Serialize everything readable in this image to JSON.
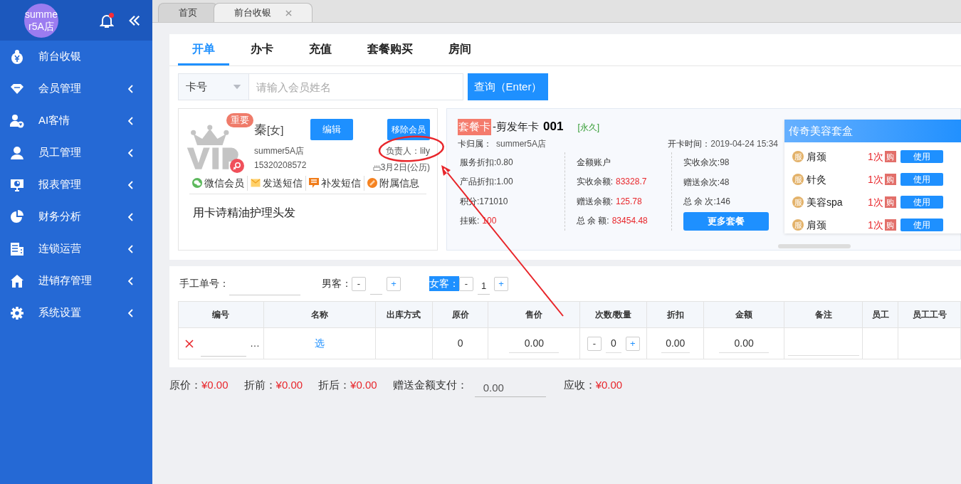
{
  "sidebar": {
    "logo_text": "summer5A店",
    "has_unread_notice": true,
    "items": [
      {
        "label": "前台收银",
        "has_submenu": false
      },
      {
        "label": "会员管理",
        "has_submenu": true
      },
      {
        "label": "AI客情",
        "has_submenu": true
      },
      {
        "label": "员工管理",
        "has_submenu": true
      },
      {
        "label": "报表管理",
        "has_submenu": true
      },
      {
        "label": "财务分析",
        "has_submenu": true
      },
      {
        "label": "连锁运营",
        "has_submenu": true
      },
      {
        "label": "进销存管理",
        "has_submenu": true
      },
      {
        "label": "系统设置",
        "has_submenu": true
      }
    ]
  },
  "page_tabs": [
    {
      "label": "首页",
      "selected": false,
      "closable": false
    },
    {
      "label": "前台收银",
      "selected": true,
      "closable": true
    }
  ],
  "sub_tabs": [
    {
      "label": "开单",
      "selected": true
    },
    {
      "label": "办卡",
      "selected": false
    },
    {
      "label": "充值",
      "selected": false
    },
    {
      "label": "套餐购买",
      "selected": false
    },
    {
      "label": "房间",
      "selected": false
    }
  ],
  "search": {
    "type_select": "卡号",
    "placeholder": "请输入会员姓名",
    "button": "查询（Enter）"
  },
  "member": {
    "badge": "重要",
    "name": "秦",
    "gender": "[女]",
    "store": "summer5A店",
    "phone": "15320208572",
    "edit_button": "编辑",
    "remove_button": "移除会员",
    "manager": "负责人：lily",
    "birthday": "3月2日(公历)",
    "actions": [
      {
        "kind": "wechat",
        "label": "微信会员"
      },
      {
        "kind": "sms",
        "label": "发送短信"
      },
      {
        "kind": "resend",
        "label": "补发短信"
      },
      {
        "kind": "extra",
        "label": "附属信息"
      }
    ],
    "note": "用卡诗精油护理头发"
  },
  "card": {
    "type_tag": "套餐卡",
    "name": "-剪发年卡",
    "number": "001",
    "validity": "[永久]",
    "owner_label": "卡归属：",
    "owner": "summer5A店",
    "open_time_label": "开卡时间：",
    "open_time": "2019-04-24 15:34",
    "columns": [
      [
        {
          "label": "服务折扣: ",
          "value": "0.80",
          "alert": false
        },
        {
          "label": "产品折扣: ",
          "value": "1.00",
          "alert": false
        },
        {
          "label": "积分: ",
          "value": "171010",
          "alert": false
        },
        {
          "label": "挂账: ",
          "value": "100",
          "alert": true
        }
      ],
      [
        {
          "label": "金额账户"
        },
        {
          "label": "实收余额: ",
          "value": "83328.7",
          "alert": true
        },
        {
          "label": "赠送余额: ",
          "value": "125.78",
          "alert": true
        },
        {
          "label": "总 余 额: ",
          "value": "83454.48",
          "alert": true
        }
      ],
      [
        {
          "label": "实收余次: ",
          "value": "98",
          "alert": false
        },
        {
          "label": "赠送余次: ",
          "value": "48",
          "alert": false
        },
        {
          "label": "总 余 次: ",
          "value": "146",
          "alert": false
        }
      ]
    ],
    "more_button": "更多套餐"
  },
  "package": {
    "title": "传奇美容套盒",
    "items": [
      {
        "tag": "服",
        "name": "肩颈",
        "count": "1次",
        "buy": "购",
        "use": "使用"
      },
      {
        "tag": "服",
        "name": "针灸",
        "count": "1次",
        "buy": "购",
        "use": "使用"
      },
      {
        "tag": "服",
        "name": "美容spa",
        "count": "1次",
        "buy": "购",
        "use": "使用"
      },
      {
        "tag": "服",
        "name": "肩颈",
        "count": "1次",
        "buy": "购",
        "use": "使用"
      }
    ]
  },
  "order": {
    "manual_no_label": "手工单号：",
    "guests": [
      {
        "label": "男客：",
        "highlighted": false,
        "minus": "-",
        "plus": "+"
      },
      {
        "label": "女客：",
        "highlighted": true,
        "minus": "-",
        "plus": "+",
        "count": "1"
      }
    ],
    "table": {
      "columns": [
        "编号",
        "名称",
        "出库方式",
        "原价",
        "售价",
        "次数/数量",
        "折扣",
        "金额",
        "备注",
        "员工",
        "员工工号"
      ],
      "rows": [
        {
          "more": "…",
          "name_link": "选",
          "original_price": "0",
          "price": "0.00",
          "minus": "-",
          "quantity": "0",
          "plus": "+",
          "discount": "0.00",
          "amount": "0.00"
        }
      ]
    }
  },
  "totals": {
    "items": [
      {
        "label": "原价：",
        "value": "¥0.00"
      },
      {
        "label": "折前：",
        "value": "¥0.00"
      },
      {
        "label": "折后：",
        "value": "¥0.00"
      }
    ],
    "gift_label": "赠送金额支付：",
    "gift_value": "0.00",
    "due_label": "应收：",
    "due_value": "¥0.00"
  }
}
